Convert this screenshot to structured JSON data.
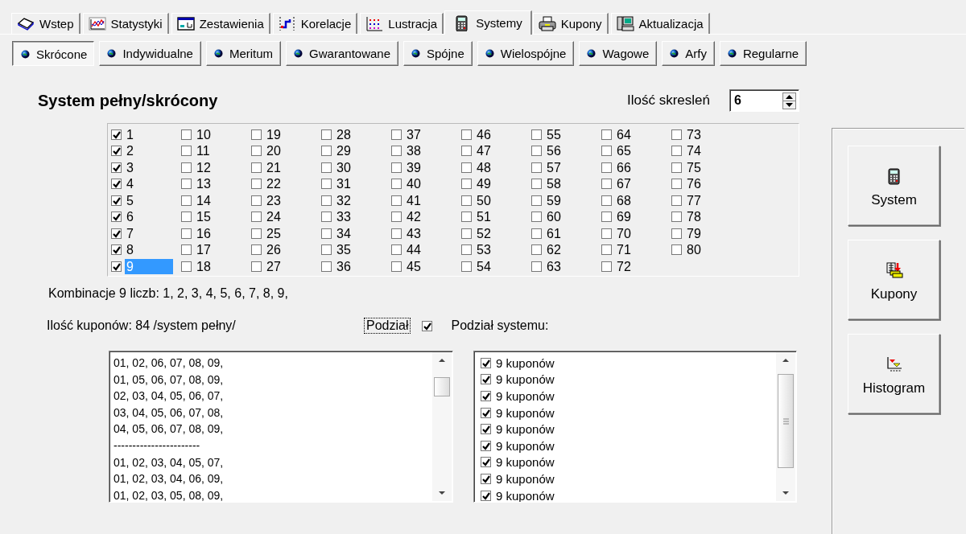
{
  "tabs": [
    {
      "label": "Wstep",
      "kind": "book",
      "selected": false
    },
    {
      "label": "Statystyki",
      "kind": "chart",
      "selected": false
    },
    {
      "label": "Zestawienia",
      "kind": "window",
      "selected": false
    },
    {
      "label": "Korelacje",
      "kind": "steps",
      "selected": false
    },
    {
      "label": "Lustracja",
      "kind": "dots",
      "selected": false
    },
    {
      "label": "Systemy",
      "kind": "calculator",
      "selected": true
    },
    {
      "label": "Kupony",
      "kind": "printer",
      "selected": false
    },
    {
      "label": "Aktualizacja",
      "kind": "computer",
      "selected": false
    }
  ],
  "subtabs": [
    {
      "label": "Skrócone",
      "selected": true
    },
    {
      "label": "Indywidualne",
      "selected": false
    },
    {
      "label": "Meritum",
      "selected": false
    },
    {
      "label": "Gwarantowane",
      "selected": false
    },
    {
      "label": "Spójne",
      "selected": false
    },
    {
      "label": "Wielospójne",
      "selected": false
    },
    {
      "label": "Wagowe",
      "selected": false
    },
    {
      "label": "Arfy",
      "selected": false
    },
    {
      "label": "Regularne",
      "selected": false
    }
  ],
  "title": "System pełny/skrócony",
  "strike_count": {
    "label": "Ilość skresleń",
    "value": "6"
  },
  "numbers": [
    {
      "label": "1",
      "checked": true,
      "selected": false
    },
    {
      "label": "2",
      "checked": true,
      "selected": false
    },
    {
      "label": "3",
      "checked": true,
      "selected": false
    },
    {
      "label": "4",
      "checked": true,
      "selected": false
    },
    {
      "label": "5",
      "checked": true,
      "selected": false
    },
    {
      "label": "6",
      "checked": true,
      "selected": false
    },
    {
      "label": "7",
      "checked": true,
      "selected": false
    },
    {
      "label": "8",
      "checked": true,
      "selected": false
    },
    {
      "label": "9",
      "checked": true,
      "selected": true
    },
    {
      "label": "10",
      "checked": false,
      "selected": false
    },
    {
      "label": "11",
      "checked": false,
      "selected": false
    },
    {
      "label": "12",
      "checked": false,
      "selected": false
    },
    {
      "label": "13",
      "checked": false,
      "selected": false
    },
    {
      "label": "14",
      "checked": false,
      "selected": false
    },
    {
      "label": "15",
      "checked": false,
      "selected": false
    },
    {
      "label": "16",
      "checked": false,
      "selected": false
    },
    {
      "label": "17",
      "checked": false,
      "selected": false
    },
    {
      "label": "18",
      "checked": false,
      "selected": false
    },
    {
      "label": "19",
      "checked": false,
      "selected": false
    },
    {
      "label": "20",
      "checked": false,
      "selected": false
    },
    {
      "label": "21",
      "checked": false,
      "selected": false
    },
    {
      "label": "22",
      "checked": false,
      "selected": false
    },
    {
      "label": "23",
      "checked": false,
      "selected": false
    },
    {
      "label": "24",
      "checked": false,
      "selected": false
    },
    {
      "label": "25",
      "checked": false,
      "selected": false
    },
    {
      "label": "26",
      "checked": false,
      "selected": false
    },
    {
      "label": "27",
      "checked": false,
      "selected": false
    },
    {
      "label": "28",
      "checked": false,
      "selected": false
    },
    {
      "label": "29",
      "checked": false,
      "selected": false
    },
    {
      "label": "30",
      "checked": false,
      "selected": false
    },
    {
      "label": "31",
      "checked": false,
      "selected": false
    },
    {
      "label": "32",
      "checked": false,
      "selected": false
    },
    {
      "label": "33",
      "checked": false,
      "selected": false
    },
    {
      "label": "34",
      "checked": false,
      "selected": false
    },
    {
      "label": "35",
      "checked": false,
      "selected": false
    },
    {
      "label": "36",
      "checked": false,
      "selected": false
    },
    {
      "label": "37",
      "checked": false,
      "selected": false
    },
    {
      "label": "38",
      "checked": false,
      "selected": false
    },
    {
      "label": "39",
      "checked": false,
      "selected": false
    },
    {
      "label": "40",
      "checked": false,
      "selected": false
    },
    {
      "label": "41",
      "checked": false,
      "selected": false
    },
    {
      "label": "42",
      "checked": false,
      "selected": false
    },
    {
      "label": "43",
      "checked": false,
      "selected": false
    },
    {
      "label": "44",
      "checked": false,
      "selected": false
    },
    {
      "label": "45",
      "checked": false,
      "selected": false
    },
    {
      "label": "46",
      "checked": false,
      "selected": false
    },
    {
      "label": "47",
      "checked": false,
      "selected": false
    },
    {
      "label": "48",
      "checked": false,
      "selected": false
    },
    {
      "label": "49",
      "checked": false,
      "selected": false
    },
    {
      "label": "50",
      "checked": false,
      "selected": false
    },
    {
      "label": "51",
      "checked": false,
      "selected": false
    },
    {
      "label": "52",
      "checked": false,
      "selected": false
    },
    {
      "label": "53",
      "checked": false,
      "selected": false
    },
    {
      "label": "54",
      "checked": false,
      "selected": false
    },
    {
      "label": "55",
      "checked": false,
      "selected": false
    },
    {
      "label": "56",
      "checked": false,
      "selected": false
    },
    {
      "label": "57",
      "checked": false,
      "selected": false
    },
    {
      "label": "58",
      "checked": false,
      "selected": false
    },
    {
      "label": "59",
      "checked": false,
      "selected": false
    },
    {
      "label": "60",
      "checked": false,
      "selected": false
    },
    {
      "label": "61",
      "checked": false,
      "selected": false
    },
    {
      "label": "62",
      "checked": false,
      "selected": false
    },
    {
      "label": "63",
      "checked": false,
      "selected": false
    },
    {
      "label": "64",
      "checked": false,
      "selected": false
    },
    {
      "label": "65",
      "checked": false,
      "selected": false
    },
    {
      "label": "66",
      "checked": false,
      "selected": false
    },
    {
      "label": "67",
      "checked": false,
      "selected": false
    },
    {
      "label": "68",
      "checked": false,
      "selected": false
    },
    {
      "label": "69",
      "checked": false,
      "selected": false
    },
    {
      "label": "70",
      "checked": false,
      "selected": false
    },
    {
      "label": "71",
      "checked": false,
      "selected": false
    },
    {
      "label": "72",
      "checked": false,
      "selected": false
    },
    {
      "label": "73",
      "checked": false,
      "selected": false
    },
    {
      "label": "74",
      "checked": false,
      "selected": false
    },
    {
      "label": "75",
      "checked": false,
      "selected": false
    },
    {
      "label": "76",
      "checked": false,
      "selected": false
    },
    {
      "label": "77",
      "checked": false,
      "selected": false
    },
    {
      "label": "78",
      "checked": false,
      "selected": false
    },
    {
      "label": "79",
      "checked": false,
      "selected": false
    },
    {
      "label": "80",
      "checked": false,
      "selected": false
    }
  ],
  "combination": "Kombinacje 9 liczb:  1, 2, 3, 4, 5, 6, 7, 8, 9,",
  "coupon_count": "Ilość kuponów: 84 /system pełny/",
  "split": {
    "label": "Podział",
    "checked": true
  },
  "split_heading": "Podział systemu:",
  "coupons": [
    "01, 02, 06, 07, 08, 09,",
    "01, 05, 06, 07, 08, 09,",
    "02, 03, 04, 05, 06, 07,",
    "03, 04, 05, 06, 07, 08,",
    "04, 05, 06, 07, 08, 09,",
    "-----------------------",
    "01, 02, 03, 04, 05, 07,",
    "01, 02, 03, 04, 06, 09,",
    "01, 02, 03, 05, 08, 09,"
  ],
  "split_items": [
    {
      "label": "9 kuponów",
      "checked": true
    },
    {
      "label": "9 kuponów",
      "checked": true
    },
    {
      "label": "9 kuponów",
      "checked": true
    },
    {
      "label": "9 kuponów",
      "checked": true
    },
    {
      "label": "9 kuponów",
      "checked": true
    },
    {
      "label": "9 kuponów",
      "checked": true
    },
    {
      "label": "9 kuponów",
      "checked": true
    },
    {
      "label": "9 kuponów",
      "checked": true
    },
    {
      "label": "9 kuponów",
      "checked": true
    }
  ],
  "actions": [
    {
      "label": "System",
      "kind": "calculator"
    },
    {
      "label": "Kupony",
      "kind": "coupons"
    },
    {
      "label": "Histogram",
      "kind": "histogram"
    }
  ]
}
